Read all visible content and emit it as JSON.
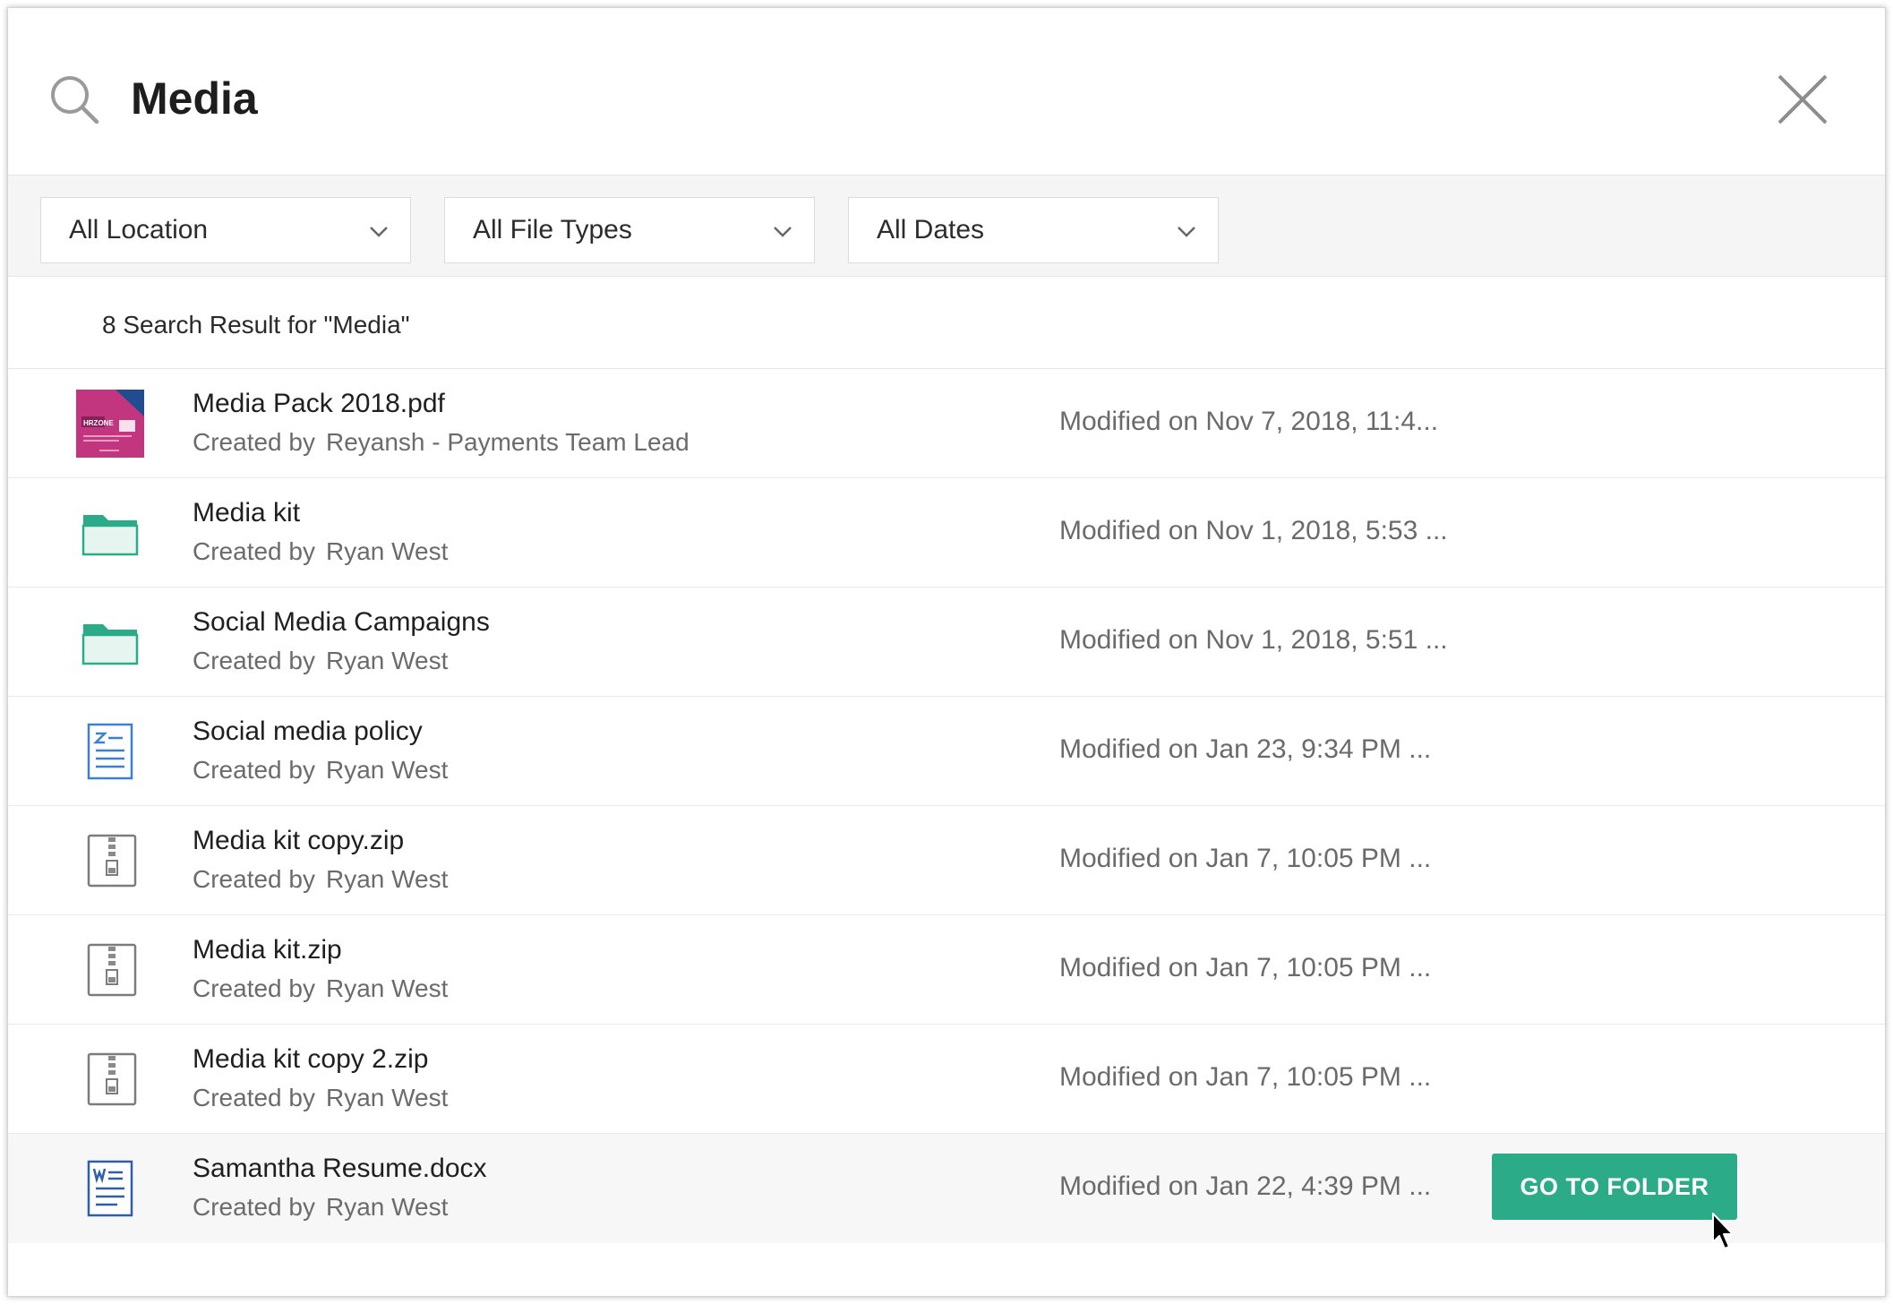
{
  "search": {
    "query": "Media"
  },
  "filters": [
    {
      "label": "All Location"
    },
    {
      "label": "All File Types"
    },
    {
      "label": "All Dates"
    }
  ],
  "results": {
    "count_text": "8 Search Result for \"Media\"",
    "created_prefix": "Created by",
    "items": [
      {
        "name": "Media Pack 2018.pdf",
        "creator": "Reyansh - Payments Team Lead",
        "modified": "Modified on Nov 7, 2018, 11:4...",
        "icon": "pdf-thumbnail-icon",
        "thumb_text": "HRZONE"
      },
      {
        "name": "Media kit",
        "creator": "Ryan West",
        "modified": "Modified on Nov 1, 2018, 5:53 ...",
        "icon": "folder-icon"
      },
      {
        "name": "Social Media Campaigns",
        "creator": "Ryan West",
        "modified": "Modified on Nov 1, 2018, 5:51 ...",
        "icon": "folder-icon"
      },
      {
        "name": "Social media policy",
        "creator": "Ryan West",
        "modified": "Modified on Jan 23, 9:34 PM ...",
        "icon": "document-icon"
      },
      {
        "name": "Media kit copy.zip",
        "creator": "Ryan West",
        "modified": "Modified on Jan 7, 10:05 PM ...",
        "icon": "zip-file-icon"
      },
      {
        "name": "Media kit.zip",
        "creator": "Ryan West",
        "modified": "Modified on Jan 7, 10:05 PM ...",
        "icon": "zip-file-icon"
      },
      {
        "name": "Media kit copy 2.zip",
        "creator": "Ryan West",
        "modified": "Modified on Jan 7, 10:05 PM ...",
        "icon": "zip-file-icon"
      },
      {
        "name": "Samantha Resume.docx",
        "creator": "Ryan West",
        "modified": "Modified on Jan 22, 4:39 PM ...",
        "icon": "word-document-icon",
        "hovered": true
      }
    ]
  },
  "actions": {
    "go_to_folder": "GO TO FOLDER"
  },
  "colors": {
    "accent": "#2bab88",
    "folder": "#2bab88",
    "doc_blue": "#3d7fd1",
    "pdf_magenta": "#c2357f"
  }
}
